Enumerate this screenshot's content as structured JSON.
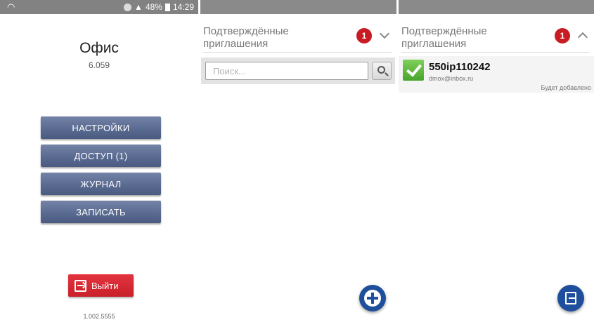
{
  "panel1": {
    "status": {
      "right_text": "48%",
      "time": "14:29"
    },
    "title": "Офис",
    "subtitle": "6.059",
    "menu": [
      {
        "label": "НАСТРОЙКИ"
      },
      {
        "label": "ДОСТУП (1)"
      },
      {
        "label": "ЖУРНАЛ"
      },
      {
        "label": "ЗАПИСАТЬ"
      }
    ],
    "logout_label": "Выйти",
    "version": "1.002.5555",
    "colors": {
      "menu_button": "#5a6b92",
      "logout_button": "#d52a33"
    }
  },
  "panel2": {
    "header_title": "Подтверждённые приглашения",
    "badge_count": "1",
    "search_placeholder": "Поиск...",
    "fab_icon": "add-icon"
  },
  "panel3": {
    "header_title": "Подтверждённые приглашения",
    "badge_count": "1",
    "item": {
      "name": "550ip110242",
      "email": "dmox@inbox.ru",
      "status": "Будет добавлено"
    },
    "fab_icon": "exit-icon"
  }
}
